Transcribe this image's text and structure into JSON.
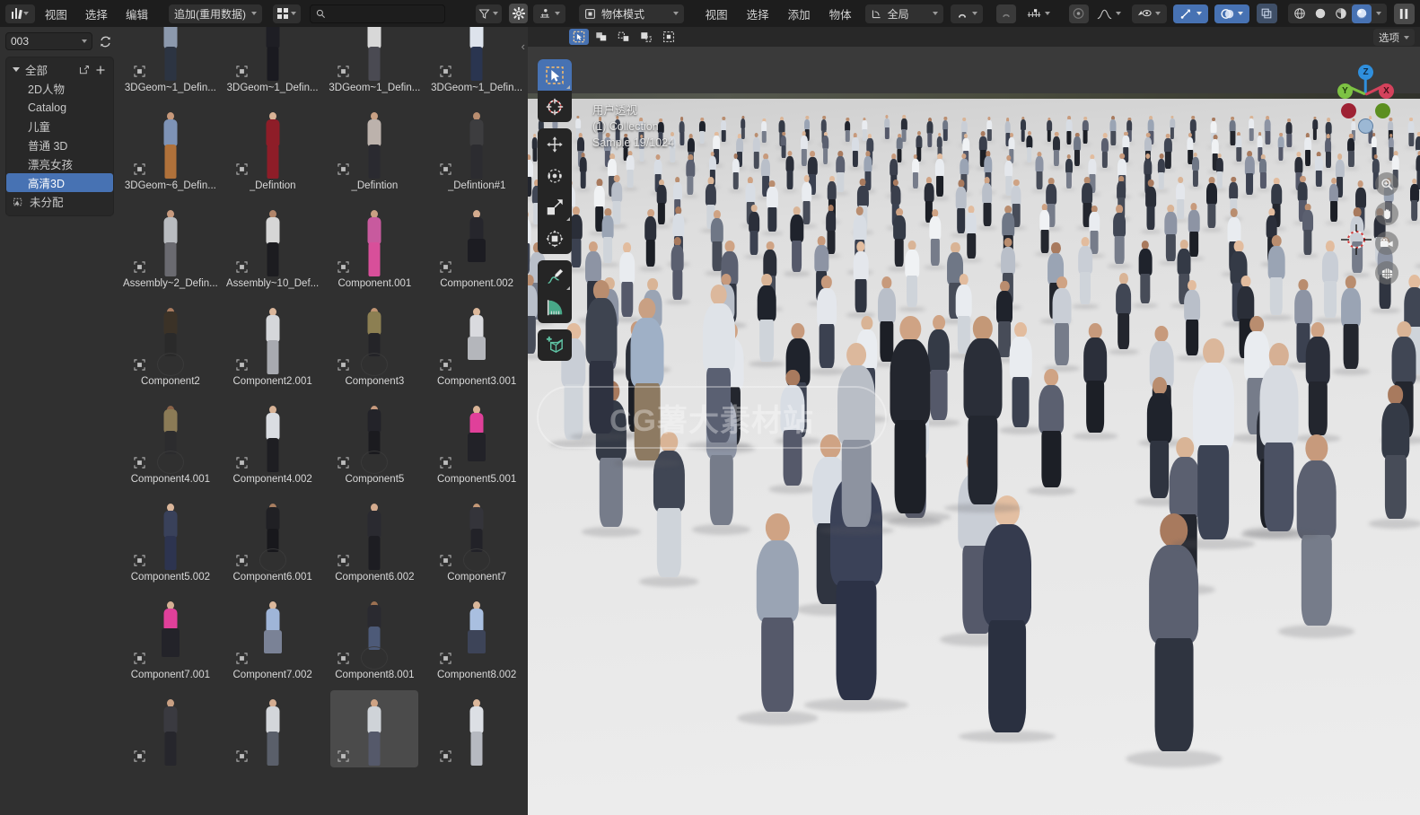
{
  "app": {
    "name": "Blender",
    "theme_accent": "#4772b3",
    "bg_dark": "#1d1d1d",
    "bg_panel": "#303030"
  },
  "asset_browser": {
    "editor_type_icon": "asset-browser-icon",
    "menus": [
      {
        "label": "视图",
        "name": "view"
      },
      {
        "label": "选择",
        "name": "select"
      },
      {
        "label": "编辑",
        "name": "edit"
      }
    ],
    "import_method": {
      "label": "追加(重用数据)",
      "icon": "chevron-down-icon"
    },
    "display_mode_icon": "grid-view-icon",
    "search": {
      "value": "",
      "placeholder": "",
      "icon": "search-icon"
    },
    "filter_icon": "funnel-filter-icon",
    "prefs_icon": "gear-icon",
    "library": {
      "value": "003",
      "refresh_icon": "refresh-icon"
    },
    "catalogs": {
      "root": {
        "label": "全部",
        "expand_icon": "triangle-down-icon",
        "new_icon": "new-catalog-icon",
        "add_icon": "plus-icon"
      },
      "items": [
        {
          "label": "2D人物",
          "selected": false
        },
        {
          "label": "Catalog",
          "selected": false
        },
        {
          "label": "儿童",
          "selected": false
        },
        {
          "label": "普通 3D",
          "selected": false
        },
        {
          "label": "漂亮女孩",
          "selected": false
        },
        {
          "label": "高清3D",
          "selected": true
        }
      ],
      "unassigned": {
        "label": "未分配",
        "icon": "unassigned-icon"
      }
    },
    "collapse_icon": "chevron-left-icon",
    "assets": [
      {
        "label": "3DGeom~1_Defin...",
        "type": "standing",
        "skin": "#c89a7c",
        "top": "#8c99ad",
        "bottom": "#2c3442",
        "selected": false
      },
      {
        "label": "3DGeom~1_Defin...",
        "type": "standing",
        "skin": "#d8b197",
        "top": "#1e1e24",
        "bottom": "#1a1a20",
        "selected": false
      },
      {
        "label": "3DGeom~1_Defin...",
        "type": "standing",
        "skin": "#d2a98e",
        "top": "#d8d8d8",
        "bottom": "#4a4a52",
        "selected": false
      },
      {
        "label": "3DGeom~1_Defin...",
        "type": "standing",
        "skin": "#d6ae93",
        "top": "#dde3ec",
        "bottom": "#2a3550",
        "selected": false
      },
      {
        "label": "3DGeom~6_Defin...",
        "type": "standing",
        "skin": "#c6987a",
        "top": "#7e93b6",
        "bottom": "#b0713a",
        "selected": false
      },
      {
        "label": "_Defintion",
        "type": "standing",
        "skin": "#d9b396",
        "top": "#8e1d28",
        "bottom": "#8e1d28",
        "selected": false
      },
      {
        "label": "_Defintion",
        "type": "standing",
        "skin": "#c9a184",
        "top": "#bcb2ac",
        "bottom": "#2a2a30",
        "selected": false
      },
      {
        "label": "_Defintion#1",
        "type": "standing",
        "skin": "#b98d6f",
        "top": "#3d3d3f",
        "bottom": "#2c2c30",
        "selected": false
      },
      {
        "label": "Assembly~2_Defin...",
        "type": "standing",
        "skin": "#c79a7e",
        "top": "#b9bcc0",
        "bottom": "#6a6a70",
        "selected": false
      },
      {
        "label": "Assembly~10_Def...",
        "type": "standing",
        "skin": "#b1856a",
        "top": "#d6d6d6",
        "bottom": "#1c1c20",
        "selected": false
      },
      {
        "label": "Component.001",
        "type": "standing",
        "skin": "#caa083",
        "top": "#c85a9e",
        "bottom": "#d84f9a",
        "selected": false
      },
      {
        "label": "Component.002",
        "type": "sitting",
        "skin": "#d3ab8e",
        "top": "#26262c",
        "bottom": "#1c1c22",
        "selected": false
      },
      {
        "label": "Component2",
        "type": "bike",
        "skin": "#a87a5e",
        "top": "#3b3227",
        "bottom": "#2a2a2a",
        "selected": false
      },
      {
        "label": "Component2.001",
        "type": "standing",
        "skin": "#dbb79b",
        "top": "#d5d7da",
        "bottom": "#a8aab0",
        "selected": false
      },
      {
        "label": "Component3",
        "type": "bike",
        "skin": "#c09472",
        "top": "#8c7f52",
        "bottom": "#242428",
        "selected": false
      },
      {
        "label": "Component3.001",
        "type": "sitting",
        "skin": "#dcb89b",
        "top": "#d9dade",
        "bottom": "#b4b6bb",
        "selected": false
      },
      {
        "label": "Component4.001",
        "type": "bike",
        "skin": "#8a6348",
        "top": "#8b7b56",
        "bottom": "#2c2c2e",
        "selected": false
      },
      {
        "label": "Component4.002",
        "type": "standing",
        "skin": "#d8b396",
        "top": "#dadde2",
        "bottom": "#1e1e22",
        "selected": false
      },
      {
        "label": "Component5",
        "type": "bike",
        "skin": "#c79a7d",
        "top": "#232329",
        "bottom": "#1b1b1f",
        "selected": false
      },
      {
        "label": "Component5.001",
        "type": "yoga",
        "skin": "#d9b496",
        "top": "#e0409a",
        "bottom": "#222228",
        "selected": false
      },
      {
        "label": "Component5.002",
        "type": "standing",
        "skin": "#dbb69a",
        "top": "#39415a",
        "bottom": "#2d3450",
        "selected": false
      },
      {
        "label": "Component6.001",
        "type": "bike",
        "skin": "#a87e60",
        "top": "#202024",
        "bottom": "#18181c",
        "selected": false
      },
      {
        "label": "Component6.002",
        "type": "standing",
        "skin": "#d4ab8e",
        "top": "#2a2a30",
        "bottom": "#1d1d22",
        "selected": false
      },
      {
        "label": "Component7",
        "type": "bike",
        "skin": "#c49877",
        "top": "#34343a",
        "bottom": "#222228",
        "selected": false
      },
      {
        "label": "Component7.001",
        "type": "yoga",
        "skin": "#d6b094",
        "top": "#e0409a",
        "bottom": "#232329",
        "selected": false
      },
      {
        "label": "Component7.002",
        "type": "sitting",
        "skin": "#dcb89c",
        "top": "#9fb5d8",
        "bottom": "#7a8296",
        "selected": false
      },
      {
        "label": "Component8.001",
        "type": "bike",
        "skin": "#9c7152",
        "top": "#2a2a30",
        "bottom": "#4d5a78",
        "selected": false
      },
      {
        "label": "Component8.002",
        "type": "sitting",
        "skin": "#d9b79b",
        "top": "#a9bfe0",
        "bottom": "#3d4458",
        "selected": false
      },
      {
        "label": "",
        "type": "standing",
        "skin": "#c9a083",
        "top": "#3a3a40",
        "bottom": "#26262c",
        "selected": false
      },
      {
        "label": "",
        "type": "standing",
        "skin": "#d5ae92",
        "top": "#d3d6da",
        "bottom": "#5a5f6a",
        "selected": false
      },
      {
        "label": "",
        "type": "standing",
        "skin": "#cfa384",
        "top": "#cfd3d8",
        "bottom": "#55596a",
        "selected": true
      },
      {
        "label": "",
        "type": "standing",
        "skin": "#dcb89c",
        "top": "#dcdfe4",
        "bottom": "#b6b9c0",
        "selected": false
      }
    ]
  },
  "viewport": {
    "editor_type_icon": "3d-viewport-icon",
    "mode": {
      "label": "物体模式",
      "icon": "object-mode-icon"
    },
    "menus": [
      {
        "label": "视图",
        "name": "view"
      },
      {
        "label": "选择",
        "name": "select"
      },
      {
        "label": "添加",
        "name": "add"
      },
      {
        "label": "物体",
        "name": "object"
      }
    ],
    "transform_orientation": {
      "label": "全局",
      "icon": "orientation-icon"
    },
    "snap_icon": "magnet-icon",
    "proportional_icon": "proportional-edit-icon",
    "falloff_icon": "falloff-curve-icon",
    "visibility_icon": "eye-visibility-icon",
    "gizmo_icon": "gizmo-icon",
    "overlays_icon": "overlays-icon",
    "xray_icon": "xray-toggle-icon",
    "shading": [
      {
        "name": "wireframe-shading-icon",
        "active": false
      },
      {
        "name": "solid-shading-icon",
        "active": false
      },
      {
        "name": "material-preview-shading-icon",
        "active": false
      },
      {
        "name": "rendered-shading-icon",
        "active": true
      }
    ],
    "pause_icon": "pause-render-icon",
    "select_modes": [
      {
        "name": "tweak-select-icon",
        "active": true
      },
      {
        "name": "box-select-icon",
        "active": false
      },
      {
        "name": "circle-select-icon",
        "active": false
      },
      {
        "name": "lasso-select-icon",
        "active": false
      },
      {
        "name": "extend-select-icon",
        "active": false
      }
    ],
    "options": {
      "label": "选项",
      "icon": "chevron-down-icon"
    },
    "info": {
      "view_name": "用户透视",
      "collection": "(1) Collection",
      "sample": "Sample 19/1024"
    },
    "toolbar": [
      {
        "name": "tool-tweak-select",
        "icon": "cursor-arrow-icon",
        "active": true
      },
      {
        "name": "tool-cursor",
        "icon": "3d-cursor-icon",
        "active": false
      },
      {
        "name": "tool-move",
        "icon": "move-arrows-icon",
        "active": false
      },
      {
        "name": "tool-rotate",
        "icon": "rotate-icon",
        "active": false
      },
      {
        "name": "tool-scale",
        "icon": "scale-icon",
        "active": false
      },
      {
        "name": "tool-transform",
        "icon": "transform-icon",
        "active": false
      },
      {
        "name": "tool-annotate",
        "icon": "annotate-pencil-icon",
        "active": false
      },
      {
        "name": "tool-measure",
        "icon": "measure-ruler-icon",
        "active": false
      },
      {
        "name": "tool-add-cube",
        "icon": "add-cube-icon",
        "active": false
      }
    ],
    "gizmo_axes": [
      {
        "label": "Z",
        "color": "#2f8fdd"
      },
      {
        "label": "Y",
        "color": "#7dc243"
      },
      {
        "label": "X",
        "color": "#d4425c"
      }
    ],
    "nav_buttons": [
      {
        "name": "zoom-nav-icon"
      },
      {
        "name": "pan-hand-icon"
      },
      {
        "name": "camera-view-icon"
      },
      {
        "name": "toggle-orthographic-icon"
      }
    ],
    "watermark": {
      "text": "CG薯大素材站"
    }
  }
}
